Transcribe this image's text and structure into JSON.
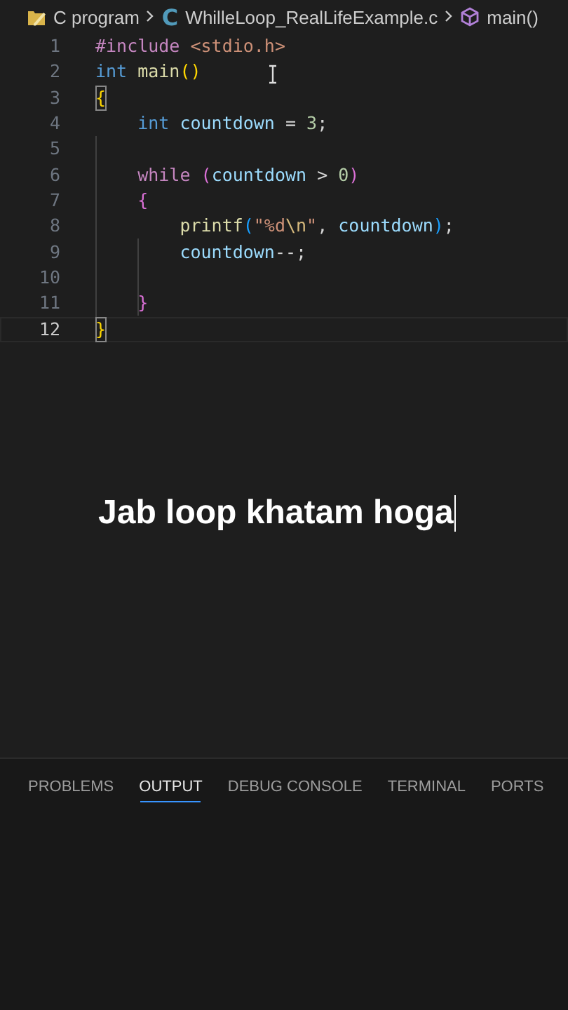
{
  "breadcrumb": [
    {
      "kind": "folder",
      "label": "C program"
    },
    {
      "kind": "file",
      "icon_text": "C",
      "label": "WhilleLoop_RealLifeExample.c"
    },
    {
      "kind": "symbol",
      "label": "main()"
    }
  ],
  "editor": {
    "lines": [
      {
        "number": "1",
        "current": false,
        "tokens": [
          {
            "kind": "directive",
            "text": "#include"
          },
          {
            "kind": "header",
            "text": " <stdio.h>"
          }
        ]
      },
      {
        "number": "2",
        "current": false,
        "tokens": [
          {
            "kind": "type",
            "text": "int"
          },
          {
            "kind": "func",
            "text": " main"
          },
          {
            "kind": "bracket1",
            "text": "()"
          }
        ]
      },
      {
        "number": "3",
        "current": false,
        "tokens": [
          {
            "kind": "bracket1",
            "text": "{",
            "matched": true
          }
        ]
      },
      {
        "number": "4",
        "current": false,
        "tokens": [
          {
            "kind": "type",
            "text": "    int"
          },
          {
            "kind": "var",
            "text": " countdown"
          },
          {
            "kind": "plain",
            "text": " ="
          },
          {
            "kind": "num",
            "text": " 3"
          },
          {
            "kind": "plain",
            "text": ";"
          }
        ]
      },
      {
        "number": "5",
        "current": false
      },
      {
        "number": "6",
        "current": false,
        "tokens": [
          {
            "kind": "keyword",
            "text": "    while"
          },
          {
            "kind": "bracket2",
            "text": " ("
          },
          {
            "kind": "var",
            "text": "countdown"
          },
          {
            "kind": "plain",
            "text": " >"
          },
          {
            "kind": "num",
            "text": " 0"
          },
          {
            "kind": "bracket2",
            "text": ")"
          }
        ]
      },
      {
        "number": "7",
        "current": false,
        "tokens": [
          {
            "kind": "bracket2",
            "text": "    {"
          }
        ]
      },
      {
        "number": "8",
        "current": false,
        "tokens": [
          {
            "kind": "func",
            "text": "        printf"
          },
          {
            "kind": "bracket3",
            "text": "("
          },
          {
            "kind": "str",
            "text": "\"%d"
          },
          {
            "kind": "esc",
            "text": "\\n"
          },
          {
            "kind": "str",
            "text": "\""
          },
          {
            "kind": "plain",
            "text": ","
          },
          {
            "kind": "var",
            "text": " countdown"
          },
          {
            "kind": "bracket3",
            "text": ")"
          },
          {
            "kind": "plain",
            "text": ";"
          }
        ]
      },
      {
        "number": "9",
        "current": false,
        "tokens": [
          {
            "kind": "var",
            "text": "        countdown"
          },
          {
            "kind": "plain",
            "text": "--;"
          }
        ]
      },
      {
        "number": "10",
        "current": false
      },
      {
        "number": "11",
        "current": false,
        "tokens": [
          {
            "kind": "bracket2",
            "text": "    }"
          }
        ]
      },
      {
        "number": "12",
        "current": true,
        "tokens": [
          {
            "kind": "bracket1",
            "text": "}",
            "matched": true
          }
        ]
      }
    ]
  },
  "caption": "Jab loop khatam hoga",
  "panel_tabs": [
    {
      "label": "PROBLEMS",
      "selected": false
    },
    {
      "label": "OUTPUT",
      "selected": true
    },
    {
      "label": "DEBUG CONSOLE",
      "selected": false
    },
    {
      "label": "TERMINAL",
      "selected": false
    },
    {
      "label": "PORTS",
      "selected": false
    }
  ]
}
